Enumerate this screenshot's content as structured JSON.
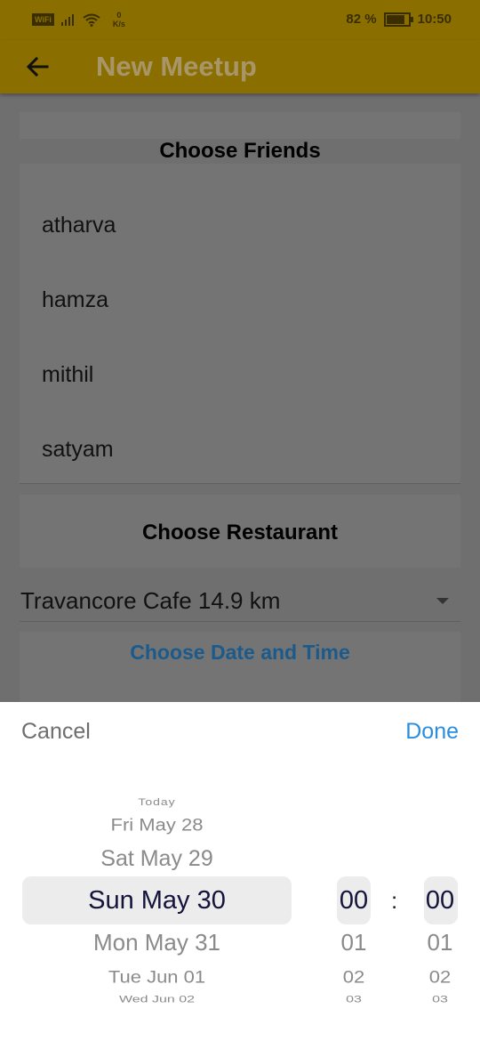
{
  "status_bar": {
    "wifi_label": "WiFi",
    "net_speed_value": "0",
    "net_speed_unit": "K/s",
    "battery_percent": "82 %",
    "battery_level": 0.82,
    "time": "10:50"
  },
  "app_bar": {
    "title": "New Meetup",
    "back_icon": "arrow-left-icon"
  },
  "friends": {
    "header": "Choose Friends",
    "items": [
      "atharva",
      "hamza",
      "mithil",
      "satyam"
    ]
  },
  "restaurant": {
    "header": "Choose Restaurant",
    "selected": "Travancore Cafe 14.9 km"
  },
  "datetime_button": "Choose Date and Time",
  "picker": {
    "cancel_label": "Cancel",
    "done_label": "Done",
    "dates": [
      "Today",
      "Fri May 28",
      "Sat May 29",
      "Sun May 30",
      "Mon May 31",
      "Tue Jun 01",
      "Wed Jun 02"
    ],
    "selected_date": "Sun May 30",
    "hours": [
      "00",
      "01",
      "02",
      "03"
    ],
    "minutes": [
      "00",
      "01",
      "02",
      "03"
    ],
    "separator": ":"
  },
  "colors": {
    "app_bar": "#FFD000",
    "accent_blue": "#2A8EE0",
    "scrim": "rgba(0,0,0,0.55)"
  }
}
